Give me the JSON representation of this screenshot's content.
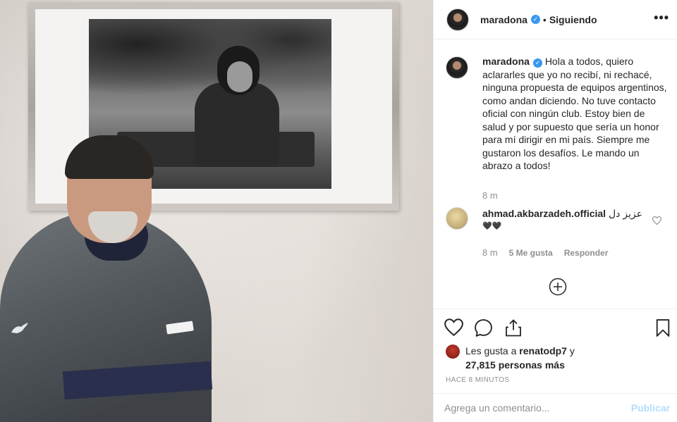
{
  "post": {
    "author": "maradona",
    "verified": true,
    "follow_separator": "•",
    "follow_state": "Siguiendo",
    "more_icon": "more-horizontal-icon"
  },
  "caption": {
    "author": "maradona",
    "text": "Hola a todos, quiero aclararles que yo no recibí, ni rechacé, ninguna propuesta de equipos argentinos, como andan diciendo. No tuve contacto oficial con ningún club. Estoy bien de salud y por supuesto que sería un honor para mí dirigir en mi país. Siempre me gustaron los desafíos. Le mando un abrazo a todos!",
    "time": "8 m"
  },
  "comments": [
    {
      "author": "ahmad.akbarzadeh.official",
      "text": "عزیز دل",
      "emoji": "🖤🖤",
      "time": "8 m",
      "likes": "5 Me gusta",
      "reply": "Responder"
    }
  ],
  "load_more_icon": "plus-circle-icon",
  "actions": {
    "like_icon": "heart-icon",
    "comment_icon": "comment-icon",
    "share_icon": "share-icon",
    "save_icon": "bookmark-icon"
  },
  "likes": {
    "prefix": "Les gusta a",
    "user": "renatodp7",
    "connector": "y",
    "count": "27,815 personas más"
  },
  "timestamp": "HACE 8 MINUTOS",
  "add_comment": {
    "placeholder": "Agrega un comentario...",
    "publish": "Publicar"
  },
  "colors": {
    "link_blue": "#3897f0",
    "publish_disabled": "#b2dffc",
    "meta_gray": "#8e8e8e",
    "text": "#262626"
  }
}
